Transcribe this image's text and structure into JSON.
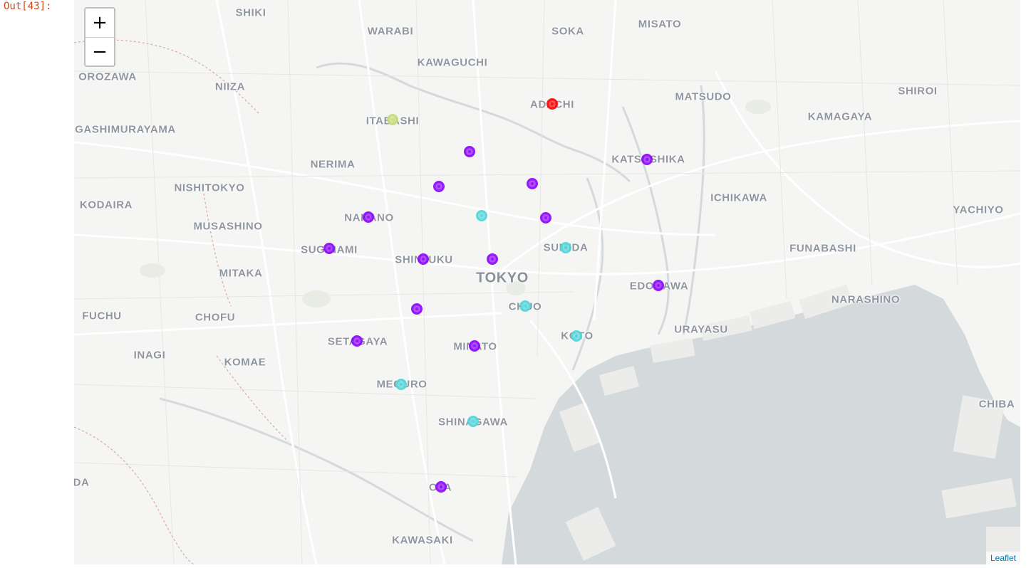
{
  "cell": {
    "out_prompt": "Out[43]:"
  },
  "map": {
    "zoom_in_label": "+",
    "zoom_out_label": "−",
    "attribution": "Leaflet",
    "colors": {
      "land": "#f5f5f4",
      "water": "#d4d9dc",
      "road": "#ffffff",
      "purple_marker": "#8b00ff",
      "cyan_marker": "#4dd6d9",
      "red_marker": "#ff0000",
      "olive_marker": "#c8dc7a"
    },
    "labels": [
      "SHIKI",
      "WARABI",
      "SOKA",
      "MISATO",
      "KAWAGUCHI",
      "OROZAWA",
      "NIIZA",
      "ADACHI",
      "MATSUDO",
      "SHIROI",
      "KAMAGAYA",
      "ITABASHI",
      "GASHIMURAYAMA",
      "KATSUSHIKA",
      "NERIMA",
      "NISHITOKYO",
      "ICHIKAWA",
      "KODAIRA",
      "NAKANO",
      "YACHIYO",
      "MUSASHINO",
      "SUGINAMI",
      "SUMIDA",
      "FUNABASHI",
      "SHINJUKU",
      "TOKYO",
      "MITAKA",
      "EDOGAWA",
      "FUCHU",
      "CHOFU",
      "CHUO",
      "NARASHINO",
      "URAYASU",
      "KOTO",
      "SETAGAYA",
      "MINATO",
      "INAGI",
      "KOMAE",
      "MEGURO",
      "CHIBA",
      "SHINAGAWA",
      "DA",
      "OTA",
      "KAWASAKI"
    ],
    "markers": [
      {
        "name": "marker-adachi",
        "color": "red"
      },
      {
        "name": "marker-itabashi",
        "color": "olive"
      },
      {
        "name": "marker-kita",
        "color": "purple"
      },
      {
        "name": "marker-katsushika",
        "color": "purple"
      },
      {
        "name": "marker-arakawa",
        "color": "purple"
      },
      {
        "name": "marker-toshima",
        "color": "purple"
      },
      {
        "name": "marker-bunkyo",
        "color": "cyan"
      },
      {
        "name": "marker-nakano",
        "color": "purple"
      },
      {
        "name": "marker-taito",
        "color": "purple"
      },
      {
        "name": "marker-suginami",
        "color": "purple"
      },
      {
        "name": "marker-sumida",
        "color": "cyan"
      },
      {
        "name": "marker-shinjuku",
        "color": "purple"
      },
      {
        "name": "marker-chiyoda",
        "color": "purple"
      },
      {
        "name": "marker-edogawa",
        "color": "purple"
      },
      {
        "name": "marker-shibuya",
        "color": "purple"
      },
      {
        "name": "marker-chuo",
        "color": "cyan"
      },
      {
        "name": "marker-koto",
        "color": "cyan"
      },
      {
        "name": "marker-setagaya",
        "color": "purple"
      },
      {
        "name": "marker-minato",
        "color": "purple"
      },
      {
        "name": "marker-meguro",
        "color": "cyan"
      },
      {
        "name": "marker-shinagawa",
        "color": "cyan"
      },
      {
        "name": "marker-ota",
        "color": "purple"
      }
    ]
  }
}
